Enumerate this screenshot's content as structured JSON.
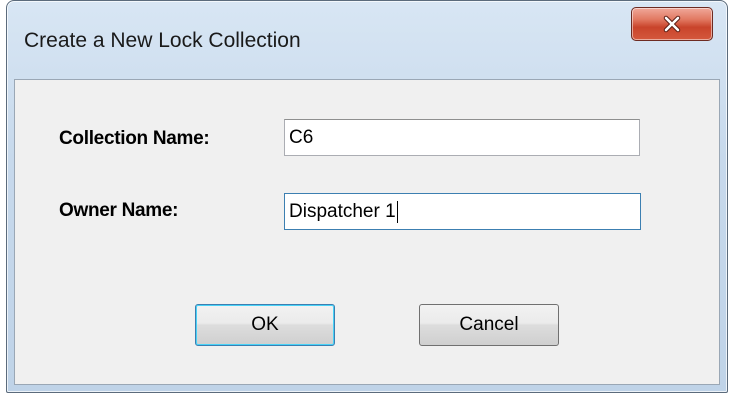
{
  "window": {
    "title": "Create a New Lock Collection",
    "close_icon": "close-x-icon"
  },
  "form": {
    "collection_name_label": "Collection Name:",
    "collection_name_value": "C6",
    "owner_name_label": "Owner Name:",
    "owner_name_value": "Dispatcher 1"
  },
  "buttons": {
    "ok_label": "OK",
    "cancel_label": "Cancel"
  },
  "colors": {
    "close_button": "#c9442b",
    "focus_border": "#3c7fb1",
    "client_background": "#f0f0f0"
  }
}
